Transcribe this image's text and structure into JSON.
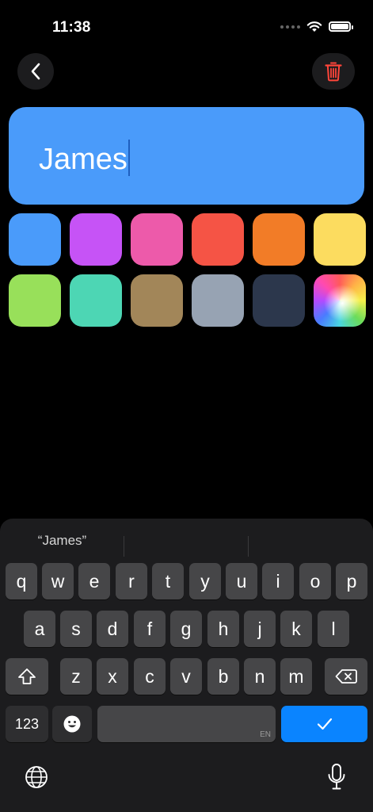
{
  "status": {
    "time": "11:38"
  },
  "nav": {
    "back_icon": "chevron-left-icon",
    "delete_icon": "trash-icon",
    "delete_color": "#ff453a"
  },
  "name_field": {
    "value": "James"
  },
  "colors": [
    {
      "name": "blue",
      "hex": "#4a9bfa"
    },
    {
      "name": "purple",
      "hex": "#c653f6"
    },
    {
      "name": "pink",
      "hex": "#ed5aaa"
    },
    {
      "name": "red",
      "hex": "#f55445"
    },
    {
      "name": "orange",
      "hex": "#f27c27"
    },
    {
      "name": "yellow",
      "hex": "#fcdc5f"
    },
    {
      "name": "green",
      "hex": "#98e05a"
    },
    {
      "name": "teal",
      "hex": "#4dd6b4"
    },
    {
      "name": "brown",
      "hex": "#a28659"
    },
    {
      "name": "gray",
      "hex": "#97a3b3"
    },
    {
      "name": "navy",
      "hex": "#2c374c"
    },
    {
      "name": "custom",
      "hex": "multicolor"
    }
  ],
  "keyboard": {
    "suggestion": "“James”",
    "row1": [
      "q",
      "w",
      "e",
      "r",
      "t",
      "y",
      "u",
      "i",
      "o",
      "p"
    ],
    "row2": [
      "a",
      "s",
      "d",
      "f",
      "g",
      "h",
      "j",
      "k",
      "l"
    ],
    "row3": [
      "z",
      "x",
      "c",
      "v",
      "b",
      "n",
      "m"
    ],
    "numbers_label": "123",
    "space_lang": "EN",
    "done_icon": "checkmark-icon",
    "globe_icon": "globe-icon",
    "mic_icon": "microphone-icon"
  }
}
